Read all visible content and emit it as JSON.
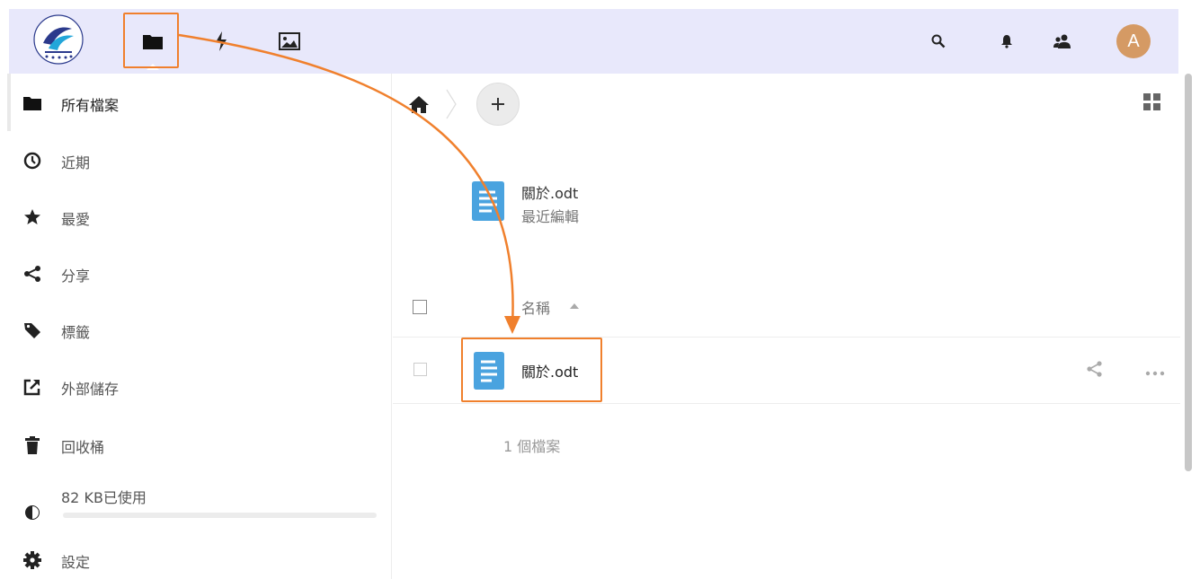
{
  "header": {
    "apps": [
      {
        "name": "files-app-icon",
        "label": ""
      },
      {
        "name": "activity-app-icon",
        "label": ""
      },
      {
        "name": "gallery-app-icon",
        "label": ""
      }
    ],
    "avatar_initial": "A"
  },
  "sidebar": {
    "items": [
      {
        "label": "所有檔案",
        "icon": "folder-icon"
      },
      {
        "label": "近期",
        "icon": "clock-icon"
      },
      {
        "label": "最愛",
        "icon": "star-icon"
      },
      {
        "label": "分享",
        "icon": "share-icon"
      },
      {
        "label": "標籤",
        "icon": "tag-icon"
      },
      {
        "label": "外部儲存",
        "icon": "external-link-icon"
      },
      {
        "label": "回收桶",
        "icon": "trash-icon"
      }
    ],
    "quota": {
      "label": "82 KB已使用",
      "fraction": 0.0
    },
    "settings_label": "設定"
  },
  "main": {
    "recent": {
      "file_name": "關於.odt",
      "subtitle": "最近編輯"
    },
    "table": {
      "name_header": "名稱",
      "rows": [
        {
          "name": "關於.odt"
        }
      ]
    },
    "summary": "1 個檔案"
  },
  "colors": {
    "header_bg": "#e8e8fb",
    "avatar_bg": "#d59a64",
    "annotation": "#f0802d",
    "doc_icon": "#4aa3df"
  }
}
